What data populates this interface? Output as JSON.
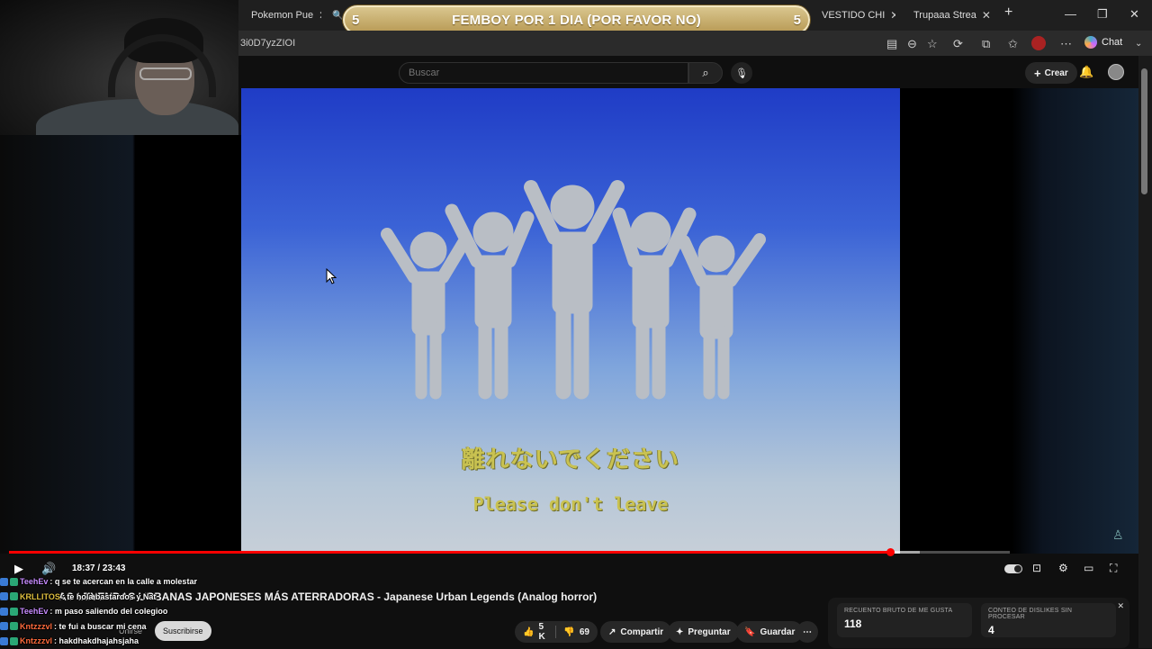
{
  "banner": {
    "left_num": "5",
    "text": "FEMBOY POR 1 DIA (POR FAVOR NO)",
    "right_num": "5"
  },
  "tabs": [
    {
      "label": "Pokemon Pue",
      "color": "#e33"
    },
    {
      "label": "VESTIDO CHI",
      "color": "#888"
    },
    {
      "label": "Trupaaa Strea",
      "color": "#4a4"
    }
  ],
  "address": {
    "url_fragment": "3i0D7yzZIOI",
    "chat_label": "Chat"
  },
  "yt_header": {
    "search_placeholder": "Buscar",
    "create_label": "Crear"
  },
  "video": {
    "subtitle_jp": "離れないでください",
    "subtitle_en": "Please don't leave",
    "time": "18:37 / 23:43",
    "progress": 0.88,
    "buffered": 0.91
  },
  "title": "AS LEYENDAS URBANAS JAPONESES MÁS ATERRADORAS - Japanese Urban Legends (Analog horror)",
  "channel": {
    "join_label": "Unirse",
    "subscribe_label": "Suscribirse"
  },
  "actions": {
    "likes": "5 K",
    "dislikes": "69",
    "share": "Compartir",
    "ask": "Preguntar",
    "save": "Guardar"
  },
  "stats": [
    {
      "label": "RECUENTO BRUTO DE ME GUSTA",
      "value": "118"
    },
    {
      "label": "CONTEO DE DISLIKES SIN PROCESAR",
      "value": "4"
    }
  ],
  "chat": [
    {
      "user": "TeehEv",
      "msg": ": q se te acercan en la calle a molestar",
      "color": "#c88cff"
    },
    {
      "user": "KRLLITOS",
      "msg": ": te hola bastardos y Nat",
      "color": "#e0c040"
    },
    {
      "user": "TeehEv",
      "msg": ": m paso saliendo del colegioo",
      "color": "#c88cff"
    },
    {
      "user": "Kntzzzvl",
      "msg": ": te fui a buscar mi cena",
      "color": "#ff6b3d"
    },
    {
      "user": "Kntzzzvl",
      "msg": ": hakdhakdhajahsjaha",
      "color": "#ff6b3d"
    }
  ],
  "colors": {
    "accent": "#ff0000",
    "banner": "#c9ac66",
    "subtitle": "#c9c251"
  }
}
